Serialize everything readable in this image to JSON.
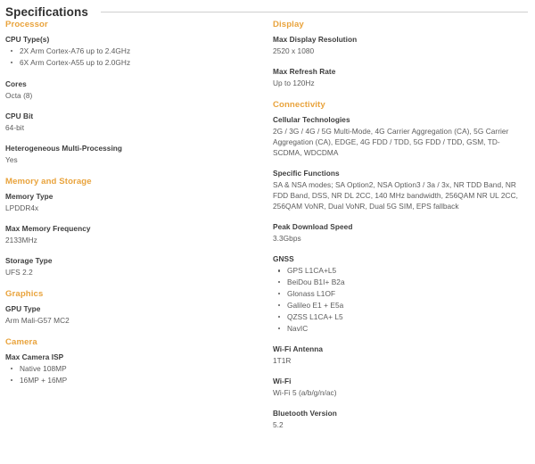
{
  "header": {
    "title": "Specifications"
  },
  "accent_color": "#e9a33c",
  "label_color": "#3d3d3d",
  "value_color": "#5b5b5b",
  "columns": {
    "left": [
      {
        "heading": "Processor",
        "specs": [
          {
            "label": "CPU Type(s)",
            "items": [
              "2X Arm Cortex-A76 up to 2.4GHz",
              "6X Arm Cortex-A55 up to 2.0GHz"
            ]
          },
          {
            "label": "Cores",
            "value": "Octa (8)"
          },
          {
            "label": "CPU Bit",
            "value": "64-bit"
          },
          {
            "label": "Heterogeneous Multi-Processing",
            "value": "Yes"
          }
        ]
      },
      {
        "heading": "Memory and Storage",
        "specs": [
          {
            "label": "Memory Type",
            "value": "LPDDR4x"
          },
          {
            "label": "Max Memory Frequency",
            "value": "2133MHz"
          },
          {
            "label": "Storage Type",
            "value": "UFS 2.2"
          }
        ]
      },
      {
        "heading": "Graphics",
        "specs": [
          {
            "label": "GPU Type",
            "value": "Arm Mali-G57 MC2"
          }
        ]
      },
      {
        "heading": "Camera",
        "specs": [
          {
            "label": "Max Camera ISP",
            "items": [
              "Native 108MP",
              "16MP + 16MP"
            ]
          }
        ]
      }
    ],
    "right": [
      {
        "heading": "Display",
        "specs": [
          {
            "label": "Max Display Resolution",
            "value": "2520 x 1080"
          },
          {
            "label": "Max Refresh Rate",
            "value": "Up to 120Hz"
          }
        ]
      },
      {
        "heading": "Connectivity",
        "specs": [
          {
            "label": "Cellular Technologies",
            "value": "2G / 3G / 4G / 5G Multi-Mode, 4G Carrier Aggregation (CA), 5G Carrier Aggregation (CA), EDGE, 4G FDD / TDD, 5G FDD / TDD, GSM, TD-SCDMA, WDCDMA"
          },
          {
            "label": "Specific Functions",
            "value": "SA & NSA modes; SA Option2, NSA Option3 / 3a / 3x, NR TDD Band, NR FDD Band, DSS, NR DL 2CC, 140 MHz bandwidth, 256QAM NR UL 2CC, 256QAM VoNR, Dual VoNR, Dual 5G SIM, EPS fallback"
          },
          {
            "label": "Peak Download Speed",
            "value": "3.3Gbps"
          },
          {
            "label": "GNSS",
            "items": [
              "GPS L1CA+L5",
              "BeiDou B1I+ B2a",
              "Glonass L1OF",
              "Galileo E1 + E5a",
              "QZSS L1CA+ L5",
              "NavIC"
            ]
          },
          {
            "label": "Wi-Fi Antenna",
            "value": "1T1R"
          },
          {
            "label": "Wi-Fi",
            "value": "Wi-Fi 5 (a/b/g/n/ac)"
          },
          {
            "label": "Bluetooth Version",
            "value": "5.2"
          }
        ]
      }
    ]
  }
}
